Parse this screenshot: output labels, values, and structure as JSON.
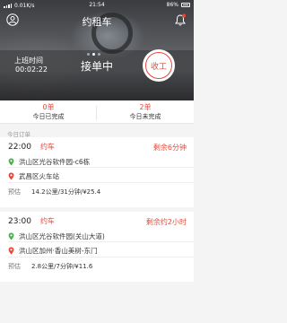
{
  "status_bar": {
    "left_text": "0.01K/s",
    "time": "21:54",
    "battery": "86%"
  },
  "header": {
    "title": "约租车",
    "user_icon": "user-circle-icon",
    "bell_icon": "bell-icon"
  },
  "shift": {
    "label": "上班时间",
    "elapsed": "00:02:22"
  },
  "order_status": "接单中",
  "clock_out_label": "收工",
  "summary": {
    "completed_count": "0单",
    "completed_label": "今日已完成",
    "pending_count": "2单",
    "pending_label": "今日未完成"
  },
  "section_label": "今日订单",
  "orders": [
    {
      "time": "22:00",
      "type": "约车",
      "remaining": "剩余6分钟",
      "from": "洪山区光谷软件园-c6栋",
      "to": "武昌区火车站",
      "estimate_label": "预估",
      "estimate": "14.2公里/31分钟/¥25.4"
    },
    {
      "time": "23:00",
      "type": "约车",
      "remaining": "剩余约2小时",
      "from": "洪山区光谷软件园(关山大道)",
      "to": "洪山区加州·香山美树-东门",
      "estimate_label": "预估",
      "estimate": "2.8公里/7分钟/¥11.6"
    }
  ],
  "colors": {
    "accent": "#e8483b",
    "from_pin": "#4caf50",
    "to_pin": "#e8483b"
  }
}
